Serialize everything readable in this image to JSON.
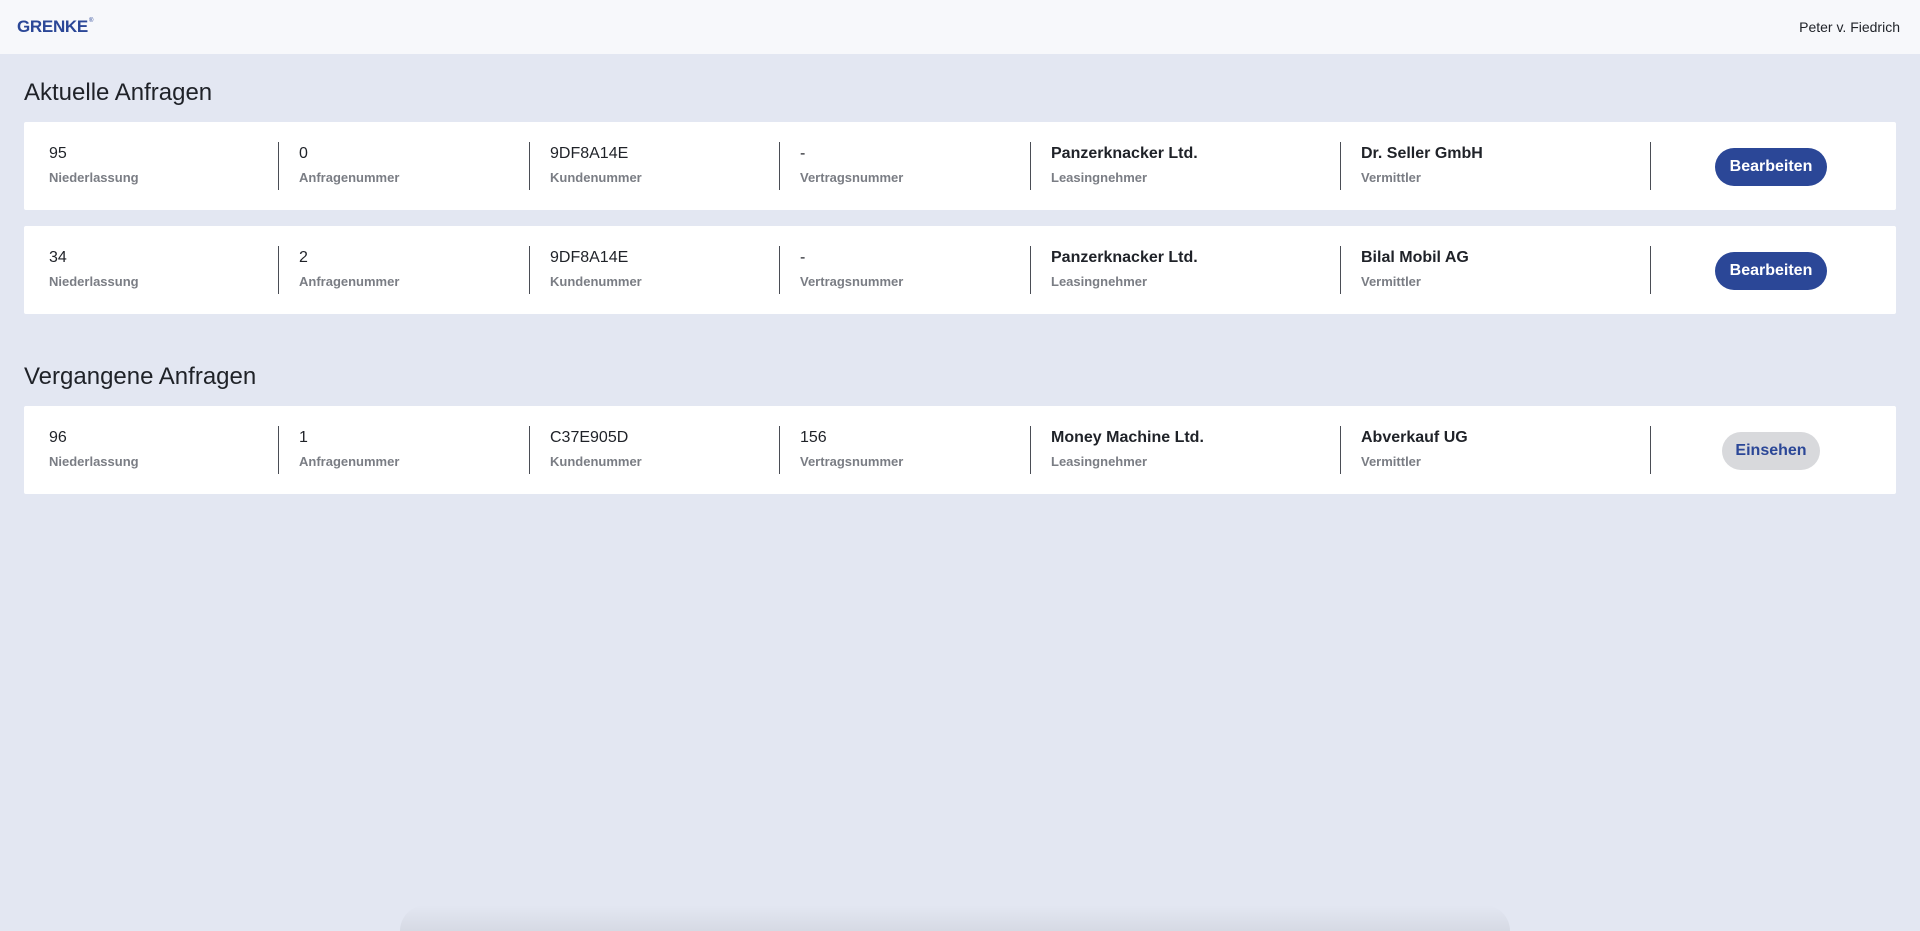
{
  "header": {
    "logo_text": "GRENKE",
    "logo_mark": "®",
    "user_name": "Peter v. Fiedrich"
  },
  "sections": {
    "current": {
      "title": "Aktuelle Anfragen"
    },
    "past": {
      "title": "Vergangene Anfragen"
    }
  },
  "labels": {
    "branch": "Niederlassung",
    "request_no": "Anfragenummer",
    "customer_no": "Kundenummer",
    "contract_no": "Vertragsnummer",
    "lessee": "Leasingnehmer",
    "broker": "Vermittler"
  },
  "current_requests": [
    {
      "branch": "95",
      "request_no": "0",
      "customer_no": "9DF8A14E",
      "contract_no": "-",
      "lessee": "Panzerknacker Ltd.",
      "broker": "Dr. Seller GmbH",
      "action": "Bearbeiten"
    },
    {
      "branch": "34",
      "request_no": "2",
      "customer_no": "9DF8A14E",
      "contract_no": "-",
      "lessee": "Panzerknacker Ltd.",
      "broker": "Bilal Mobil AG",
      "action": "Bearbeiten"
    }
  ],
  "past_requests": [
    {
      "branch": "96",
      "request_no": "1",
      "customer_no": "C37E905D",
      "contract_no": "156",
      "lessee": "Money Machine Ltd.",
      "broker": "Abverkauf UG",
      "action": "Einsehen"
    }
  ],
  "colors": {
    "brand": "#2b4797",
    "page_bg": "#e3e7f2",
    "secondary_button_bg": "#d8d9dc"
  }
}
